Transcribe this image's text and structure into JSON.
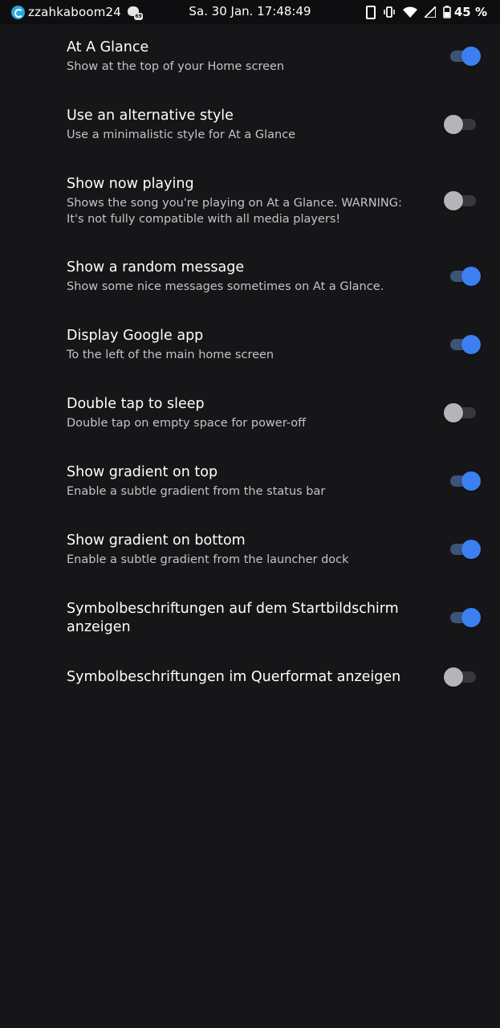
{
  "status_bar": {
    "user_icon": "app-circle-icon",
    "username": "zzahkaboom24",
    "notification_icon": "cat-badge-icon",
    "notification_badge": "69",
    "datetime": "Sa. 30 Jan. 17:48:49",
    "battery_percent": "45 %",
    "icons": [
      "phone-icon",
      "vibrate-icon",
      "wifi-icon",
      "signal-icon",
      "battery-icon"
    ]
  },
  "colors": {
    "background": "#161618",
    "accent": "#3b7ff0",
    "track_on": "#3d5478",
    "thumb_off": "#b5b5b8",
    "track_off": "#38383c"
  },
  "settings": [
    {
      "title": "At A Glance",
      "summary": "Show at the top of your Home screen",
      "enabled": true
    },
    {
      "title": "Use an alternative style",
      "summary": "Use a minimalistic style for At a Glance",
      "enabled": false
    },
    {
      "title": "Show now playing",
      "summary": "Shows the song you're playing on At a Glance. WARNING: It's not fully compatible with all media players!",
      "enabled": false
    },
    {
      "title": "Show a random message",
      "summary": "Show some nice messages sometimes on At a Glance.",
      "enabled": true
    },
    {
      "title": "Display Google app",
      "summary": "To the left of the main home screen",
      "enabled": true
    },
    {
      "title": "Double tap to sleep",
      "summary": "Double tap on empty space for power-off",
      "enabled": false
    },
    {
      "title": "Show gradient on top",
      "summary": "Enable a subtle gradient from the status bar",
      "enabled": true
    },
    {
      "title": "Show gradient on bottom",
      "summary": "Enable a subtle gradient from the launcher dock",
      "enabled": true
    },
    {
      "title": "Symbolbeschriftungen auf dem Startbildschirm anzeigen",
      "summary": "",
      "enabled": true
    },
    {
      "title": "Symbolbeschriftungen im Querformat anzeigen",
      "summary": "",
      "enabled": false
    }
  ]
}
